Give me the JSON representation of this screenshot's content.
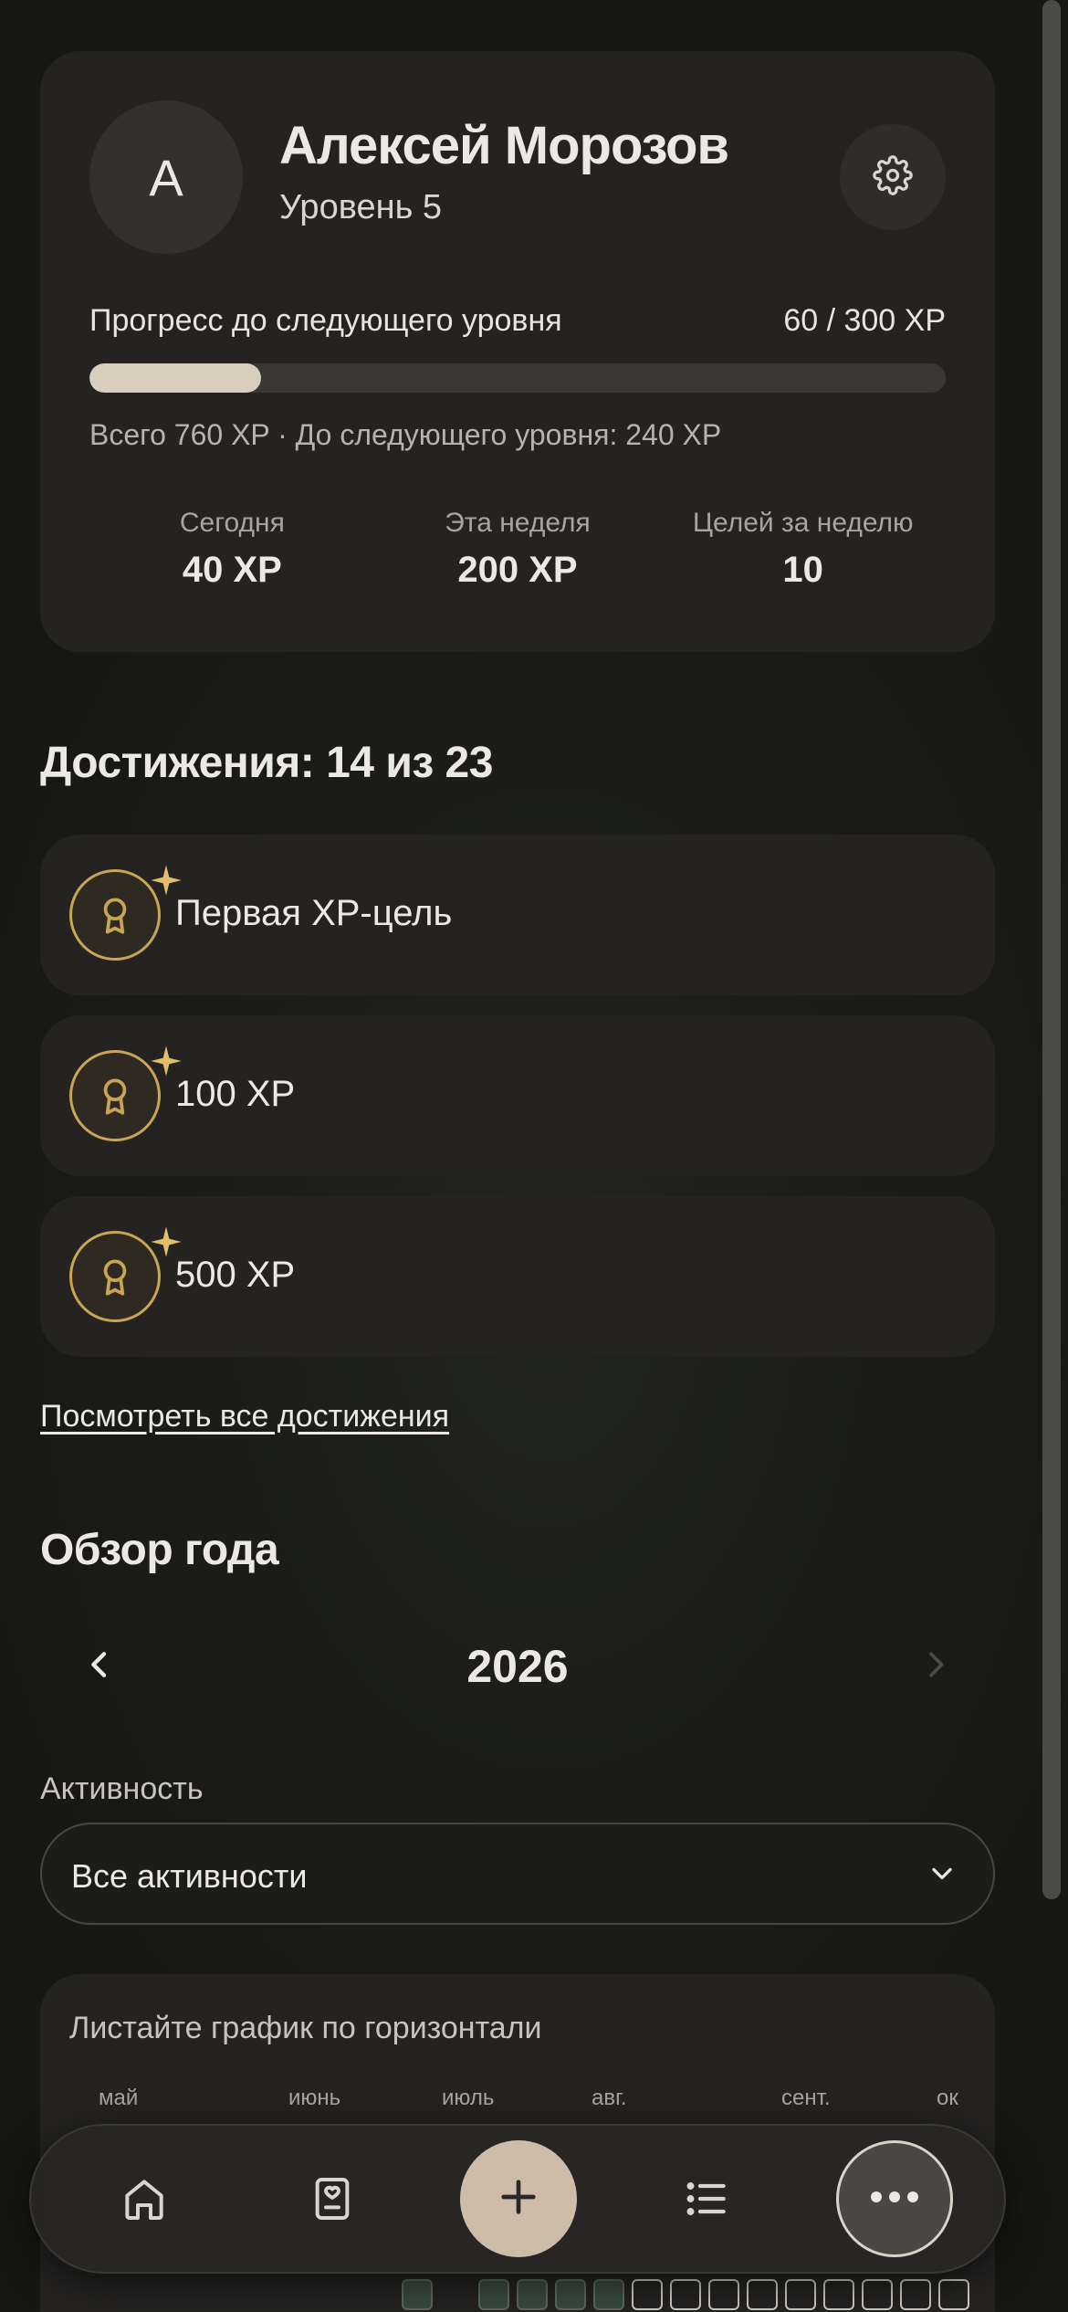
{
  "profile": {
    "avatar_initial": "А",
    "name": "Алексей Морозов",
    "level": "Уровень 5",
    "progress_label": "Прогресс до следующего уровня",
    "progress_value": "60 / 300 XP",
    "progress_fraction": 0.2,
    "progress_summary": "Всего 760 XP · До следующего уровня: 240 XP",
    "stats": [
      {
        "label": "Сегодня",
        "value": "40 XP"
      },
      {
        "label": "Эта неделя",
        "value": "200 XP"
      },
      {
        "label": "Целей за неделю",
        "value": "10"
      }
    ]
  },
  "achievements": {
    "title": "Достижения: 14 из 23",
    "items": [
      {
        "label": "Первая XP-цель"
      },
      {
        "label": "100 XP"
      },
      {
        "label": "500 XP"
      }
    ],
    "see_all": "Посмотреть все достижения"
  },
  "year_overview": {
    "title": "Обзор года",
    "year": "2026",
    "activity_label": "Активность",
    "activity_selected": "Все активности",
    "chart_hint": "Листайте график по горизонтали",
    "months": [
      "май",
      "июнь",
      "июль",
      "авг.",
      "сент.",
      "ок"
    ]
  },
  "colors": {
    "accent_gold": "#C9A455",
    "progress_fill": "#D9CDBE",
    "add_button": "#CDBCA8"
  },
  "bottom_nav": [
    "home-icon",
    "journal-icon",
    "plus-icon",
    "list-icon",
    "more-icon"
  ]
}
